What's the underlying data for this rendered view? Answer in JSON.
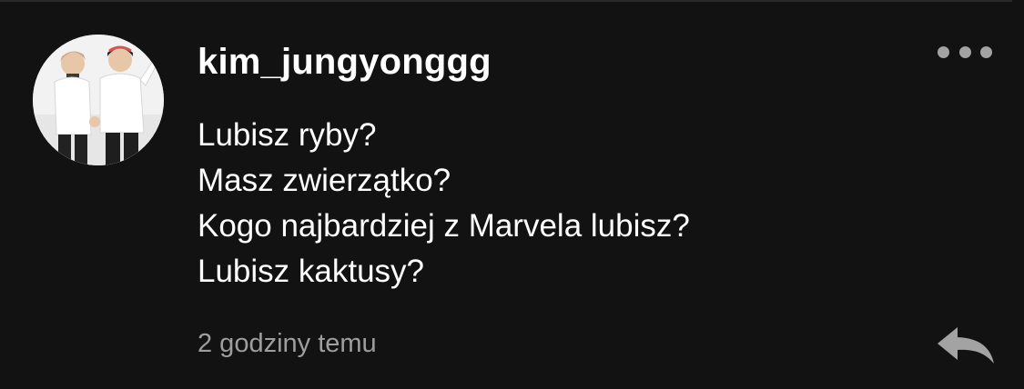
{
  "comment": {
    "author": "kim_jungyonggg",
    "lines": [
      "Lubisz ryby?",
      "Masz zwierzątko?",
      "Kogo najbardziej z Marvela lubisz?",
      "Lubisz kaktusy?"
    ],
    "timestamp": "2 godziny temu"
  },
  "icons": {
    "more": "more-horizontal-icon",
    "reply": "reply-arrow-icon"
  },
  "colors": {
    "background": "#121212",
    "text": "#ffffff",
    "muted": "#9e9e9e",
    "icon": "#a3a3a3"
  }
}
